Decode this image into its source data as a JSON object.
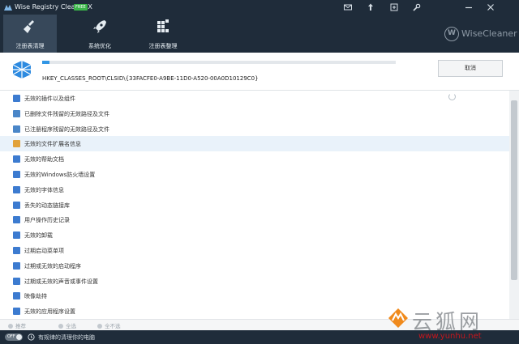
{
  "titlebar": {
    "title": "Wise Registry Cleaner X",
    "badge": "FREE",
    "icons": [
      "mail-icon",
      "pin-icon",
      "settings-menu-icon",
      "wrench-icon",
      "minimize-icon",
      "close-icon"
    ]
  },
  "nav": {
    "tabs": [
      {
        "label": "注册表清理",
        "icon": "broom-icon",
        "active": true
      },
      {
        "label": "系统优化",
        "icon": "rocket-icon",
        "active": false
      },
      {
        "label": "注册表整理",
        "icon": "blocks-icon",
        "active": false
      }
    ],
    "brand": "WiseCleaner"
  },
  "scan": {
    "path": "HKEY_CLASSES_ROOT\\CLSID\\{33FACFE0-A9BE-11D0-A520-00A0D10129C0}",
    "progress_percent": 2,
    "cancel_label": "取消"
  },
  "items": [
    {
      "label": "无效的插件以及组件",
      "color": "#3c7bd0"
    },
    {
      "label": "已删除文件残留的无效路径及文件",
      "color": "#4a86c8"
    },
    {
      "label": "已注册程序残留的无效路径及文件",
      "color": "#4a86c8"
    },
    {
      "label": "无效的文件扩展名信息",
      "color": "#e2a23a"
    },
    {
      "label": "无效的帮助文档",
      "color": "#3c7bd0"
    },
    {
      "label": "无效的Windows防火墙设置",
      "color": "#3c7bd0"
    },
    {
      "label": "无效的字体信息",
      "color": "#3c7bd0"
    },
    {
      "label": "丢失的动态链接库",
      "color": "#3c7bd0"
    },
    {
      "label": "用户操作历史记录",
      "color": "#3c7bd0"
    },
    {
      "label": "无效的卸载",
      "color": "#3c7bd0"
    },
    {
      "label": "过期启动菜单项",
      "color": "#3c7bd0"
    },
    {
      "label": "过期或无效的启动程序",
      "color": "#3c7bd0"
    },
    {
      "label": "过期或无效的声音或事件设置",
      "color": "#3c7bd0"
    },
    {
      "label": "映像劫持",
      "color": "#3c7bd0"
    },
    {
      "label": "无效的应用程序设置",
      "color": "#3c7bd0"
    }
  ],
  "actions": {
    "recommend": "推荐",
    "select_all": "全选",
    "select_none": "全不选"
  },
  "status": {
    "toggle": "OFF",
    "text": "有规律的清理你的电脑"
  },
  "watermark": {
    "chinese": "云狐网",
    "url": "www.yunhu.net"
  },
  "colors": {
    "chrome": "#1f2c3a",
    "active_tab": "#37485a",
    "progress": "#3196e5",
    "highlight_row": "#e9f2fa"
  }
}
